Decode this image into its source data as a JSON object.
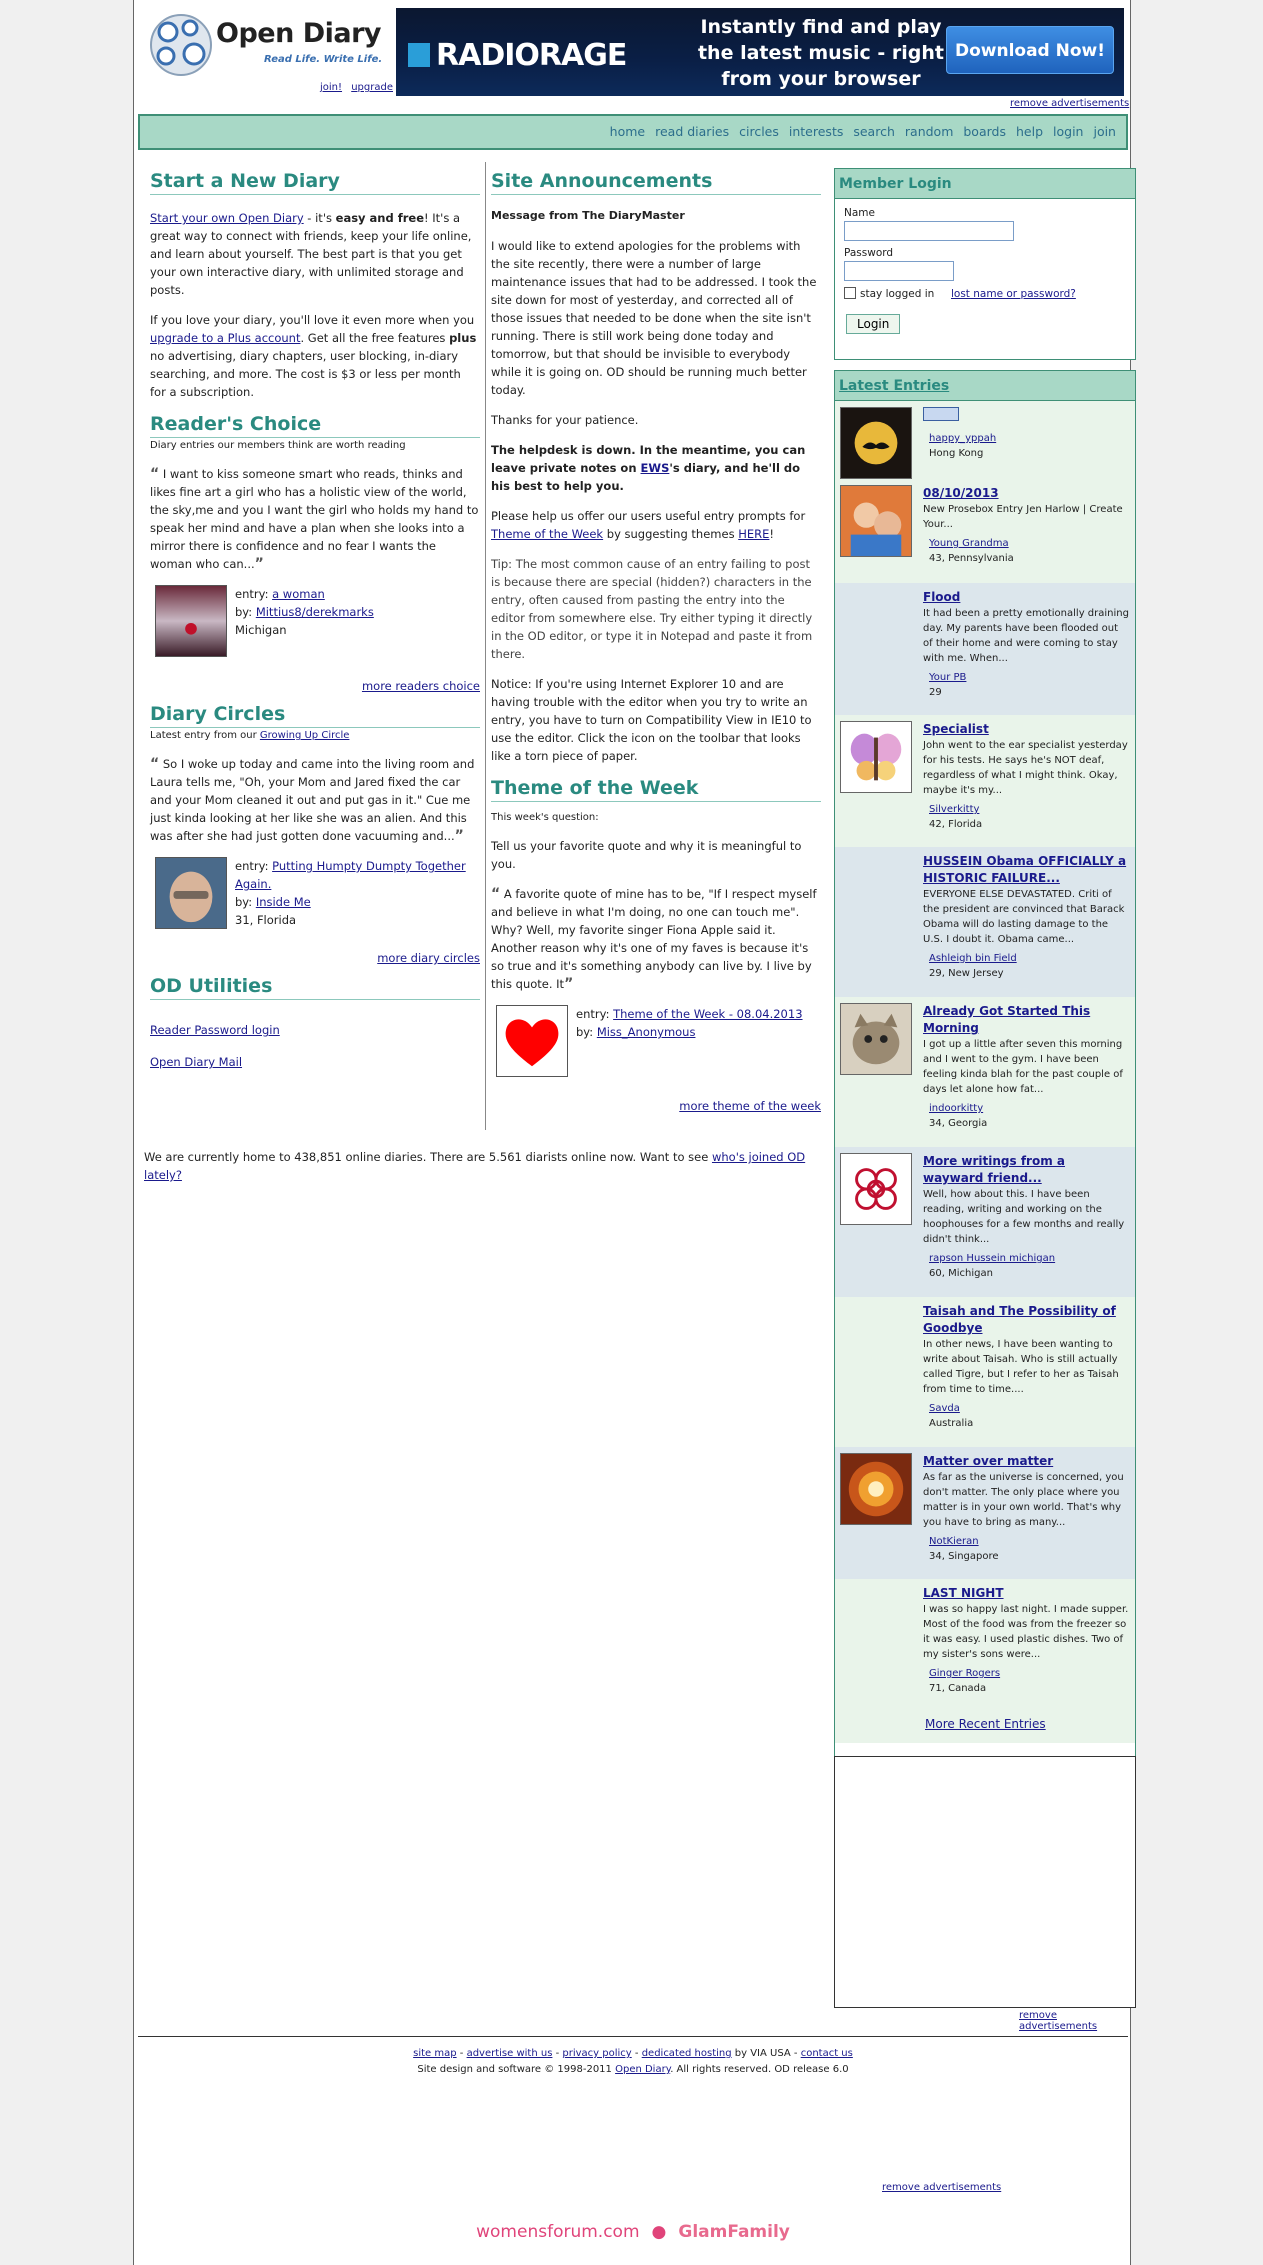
{
  "header": {
    "logo_title": "Open Diary",
    "logo_tagline": "Read Life. Write Life.",
    "join_label": "join!",
    "upgrade_label": "upgrade",
    "banner_brand": "RADIORAGE",
    "banner_copy": "Instantly find and play the latest music - right from your browser",
    "banner_button": "Download Now!",
    "remove_ads": "remove advertisements"
  },
  "nav": [
    "home",
    "read diaries",
    "circles",
    "interests",
    "search",
    "random",
    "boards",
    "help",
    "login",
    "join"
  ],
  "start": {
    "title": "Start a New Diary",
    "p1_link": "Start your own Open Diary",
    "p1_a": " - it's ",
    "p1_bold": "easy and free",
    "p1_b": "! It's a great way to connect with friends, keep your life online, and learn about yourself. The best part is that you get your own interactive diary, with unlimited storage and posts.",
    "p2_a": "If you love your diary, you'll love it even more when you ",
    "p2_link": "upgrade to a Plus account",
    "p2_b": ". Get all the free features ",
    "p2_bold": "plus",
    "p2_c": " no advertising, diary chapters, user blocking, in-diary searching, and more. The cost is $3 or less per month for a subscription."
  },
  "readers_choice": {
    "title": "Reader's Choice",
    "sub": "Diary entries our members think are worth reading",
    "quote": "I want to kiss someone smart who reads, thinks and likes fine art a girl who has a holistic view of the world, the sky,me and you I want the girl who holds my hand to speak her mind and have a plan when she looks into a mirror there is confidence and no fear I wants the woman who can...",
    "entry_label": "entry: ",
    "entry_link": "a woman",
    "by_label": "by: ",
    "author": "Mittius8/derekmarks",
    "location": "Michigan",
    "more": "more readers choice"
  },
  "circles": {
    "title": "Diary Circles",
    "sub_a": "Latest entry from our ",
    "sub_link": "Growing Up Circle",
    "quote": "So I woke up today and came into the living room and Laura tells me, \"Oh, your Mom and Jared fixed the car and your Mom cleaned it out and put gas in it.\" Cue me just kinda looking at her like she was an alien. And this was after she had just gotten done vacuuming and...",
    "entry_label": "entry: ",
    "entry_link": "Putting Humpty Dumpty Together Again.",
    "by_label": "by: ",
    "author": "Inside Me",
    "location": "31, Florida",
    "more": "more diary circles"
  },
  "utilities": {
    "title": "OD Utilities",
    "items": [
      "Reader Password login",
      "Open Diary Mail"
    ]
  },
  "announcements": {
    "title": "Site Announcements",
    "from": "Message from The DiaryMaster",
    "p1": "I would like to extend apologies for the problems with the site recently, there were a number of large maintenance issues that had to be addressed. I took the site down for most of yesterday, and corrected all of those issues that needed to be done when the site isn't running. There is still work being done today and tomorrow, but that should be invisible to everybody while it is going on. OD should be running much better today.",
    "p2": "Thanks for your patience.",
    "p3_a": "The helpdesk is down. In the meantime, you can leave private notes on ",
    "p3_link": "EWS",
    "p3_b": "'s diary, and he'll do his best to help you.",
    "p4_a": "Please help us offer our users useful entry prompts for ",
    "p4_link1": "Theme of the Week",
    "p4_b": " by suggesting themes ",
    "p4_link2": "HERE",
    "p4_c": "!",
    "p5": "Tip: The most common cause of an entry failing to post is because there are special (hidden?) characters in the entry, often caused from pasting the entry into the editor from somewhere else. Try either typing it directly in the OD editor, or type it in Notepad and paste it from there.",
    "p6": "Notice: If you're using Internet Explorer 10 and are having trouble with the editor when you try to write an entry, you have to turn on Compatibility View in IE10 to use the editor. Click the icon on the toolbar that looks like a torn piece of paper."
  },
  "theme": {
    "title": "Theme of the Week",
    "sub": "This week's question:",
    "question": "Tell us your favorite quote and why it is meaningful to you.",
    "quote": "A favorite quote of mine has to be, \"If I respect myself and believe in what I'm doing, no one can touch me\". Why? Well, my favorite singer Fiona Apple said it. Another reason why it's one of my faves is because it's so true and it's something anybody can live by. I live by this quote. It",
    "entry_label": "entry: ",
    "entry_link": "Theme of the Week - 08.04.2013",
    "by_label": "by: ",
    "author": "Miss_Anonymous",
    "more": "more theme of the week"
  },
  "login": {
    "title": "Member Login",
    "name_label": "Name",
    "password_label": "Password",
    "stay_label": "stay logged in",
    "lost_link": "lost name or password?",
    "button": "Login"
  },
  "latest": {
    "title": "Latest Entries",
    "items": [
      {
        "title": "",
        "excerpt": "",
        "author": "happy_yppah",
        "location": "Hong Kong",
        "icon": "mustache-moon-icon",
        "h": 78
      },
      {
        "title": "08/10/2013",
        "excerpt": "New Prosebox Entry Jen Harlow | Create Your...",
        "author": "Young Grandma",
        "location": "43, Pennsylvania",
        "icon": "family-photo-icon",
        "h": 104
      },
      {
        "title": "Flood",
        "excerpt": "It had been a pretty emotionally draining day. My parents have been flooded out of their home and were coming to stay with me. When...",
        "author": "Your PB",
        "location": "29",
        "icon": "",
        "h": 132
      },
      {
        "title": "Specialist",
        "excerpt": "John went to the ear specialist yesterday for his tests. He says he's NOT deaf, regardless of what I might think. Okay, maybe it's my...",
        "author": "Silverkitty",
        "location": "42, Florida",
        "icon": "butterfly-icon",
        "h": 132
      },
      {
        "title": "HUSSEIN Obama OFFICIALLY a HISTORIC FAILURE...",
        "excerpt": "EVERYONE ELSE DEVASTATED. Criti of the president are convinced that Barack Obama will do lasting damage to the U.S. I doubt it. Obama came...",
        "author": "Ashleigh bin Field",
        "location": "29, New Jersey",
        "icon": "",
        "h": 150
      },
      {
        "title": "Already Got Started This Morning",
        "excerpt": "I got up a little after seven this morning and I went to the gym. I have been feeling kinda blah for the past couple of days let alone how fat...",
        "author": "indoorkitty",
        "location": "34, Georgia",
        "icon": "kitten-icon",
        "h": 150
      },
      {
        "title": "More writings from a wayward friend...",
        "excerpt": "Well, how about this. I have been reading, writing and working on the hoophouses for a few months and really didn't think...",
        "author": "rapson Hussein michigan",
        "location": "60, Michigan",
        "icon": "celtic-knot-icon",
        "h": 150
      },
      {
        "title": "Taisah and The Possibility of Goodbye",
        "excerpt": "In other news, I have been wanting to write about Taisah. Who is still actually called Tigre, but I refer to her as Taisah from time to time....",
        "author": "Savda",
        "location": "Australia",
        "icon": "",
        "h": 150
      },
      {
        "title": "Matter over matter",
        "excerpt": "As far as the universe is concerned, you don't matter. The only place where you matter is in your own world. That's why you have to bring as many...",
        "author": "NotKieran",
        "location": "34, Singapore",
        "icon": "mandala-icon",
        "h": 132
      },
      {
        "title": "LAST NIGHT",
        "excerpt": "I was so happy last night. I made supper. Most of the food was from the freezer so it was easy. I used plastic dishes. Two of my sister's sons were...",
        "author": "Ginger Rogers",
        "location": "71, Canada",
        "icon": "",
        "h": 132
      }
    ],
    "more": "More Recent Entries"
  },
  "online": {
    "text_a": "We are currently home to 438,851 online diaries. There are 5.561 diarists online now. Want to see ",
    "link": "who's joined OD lately?"
  },
  "footer": {
    "links": [
      "site map",
      "advertise with us",
      "privacy policy",
      "dedicated hosting"
    ],
    "by_via": " by VIA USA ",
    "contact": "contact us",
    "copyright_a": "Site design and software © 1998-2011 ",
    "copyright_link": "Open Diary",
    "copyright_b": ". All rights reserved. OD release 6.0",
    "remove_ads": "remove advertisements",
    "brand_womens": "womensforum.com",
    "brand_glam": "GlamFamily"
  },
  "colors": {
    "accent": "#2a8a80",
    "nav_bg": "#a8d8c6",
    "link": "#1a1a8c"
  }
}
